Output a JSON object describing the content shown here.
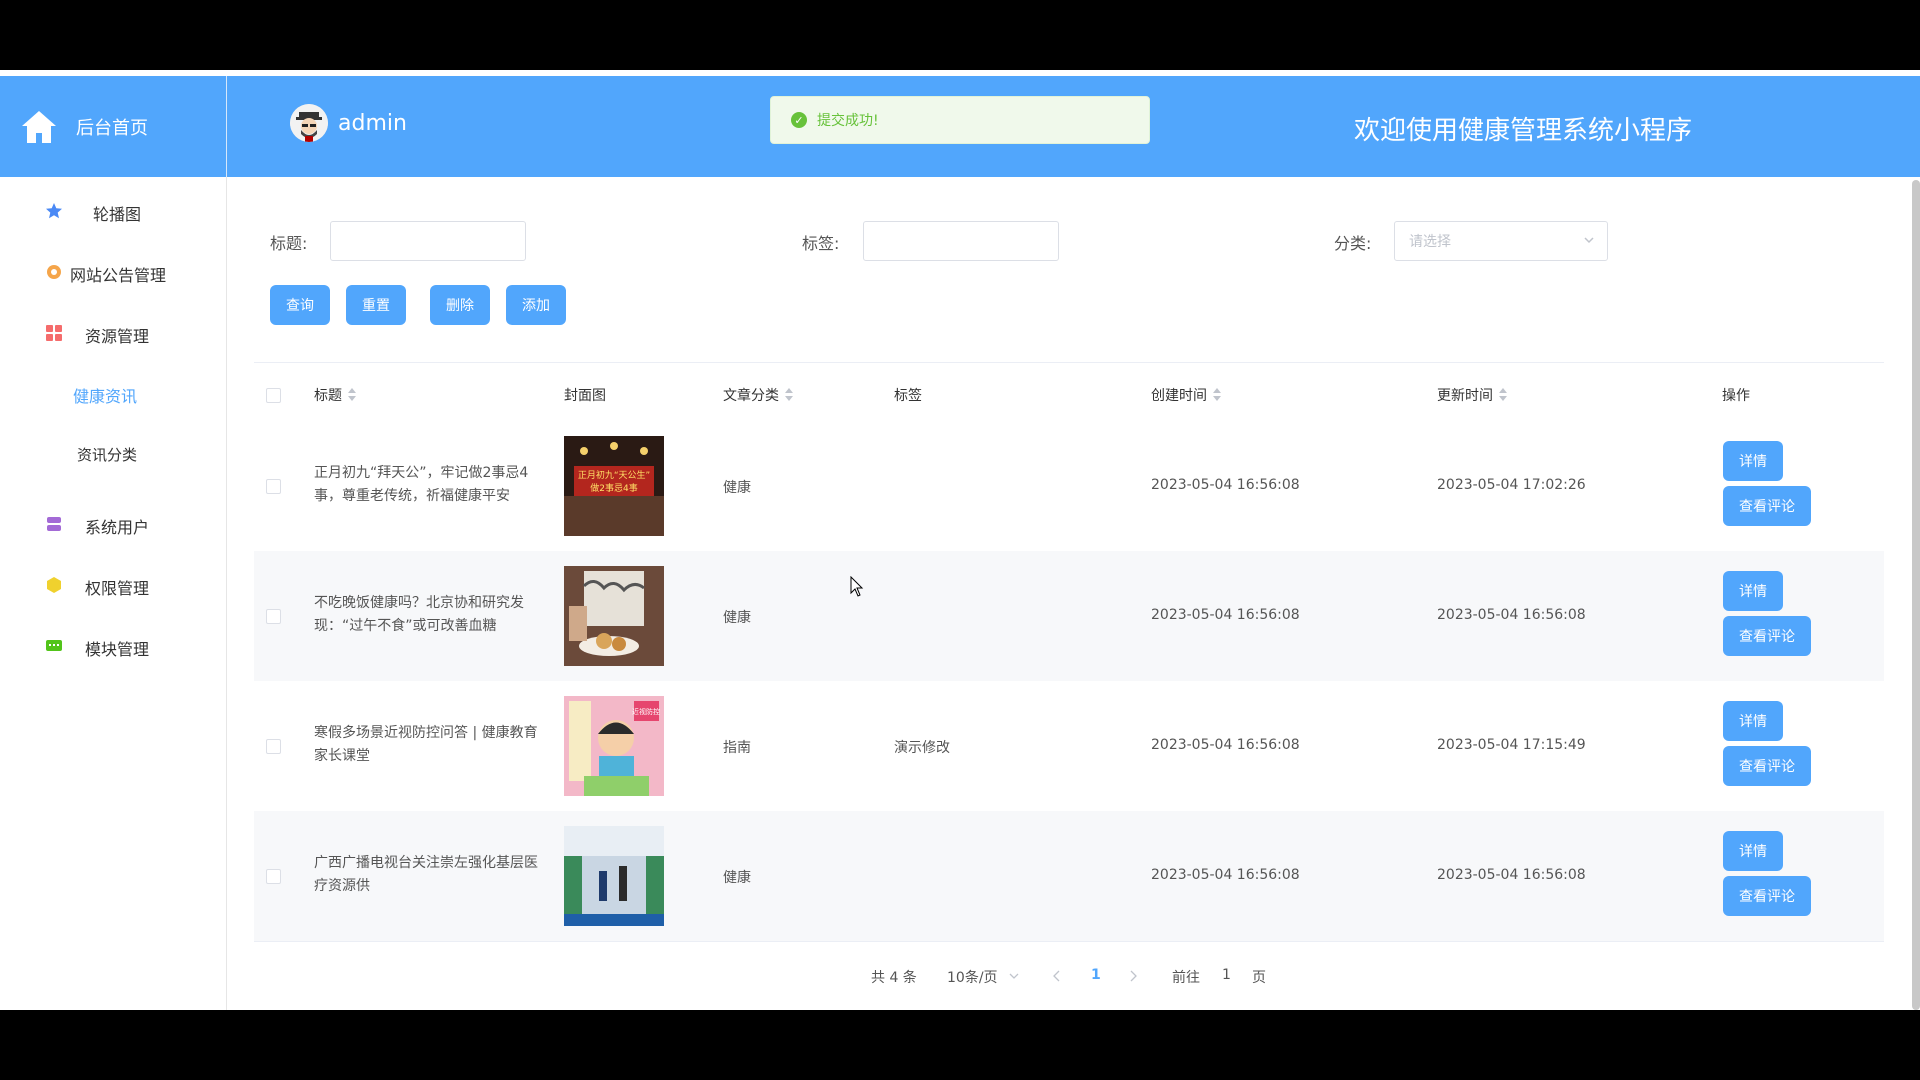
{
  "header": {
    "brand_label": "后台首页",
    "username": "admin",
    "toast_message": "提交成功!",
    "welcome": "欢迎使用健康管理系统小程序"
  },
  "sidebar": {
    "items": [
      {
        "label": "轮播图",
        "icon": "star-icon"
      },
      {
        "label": "网站公告管理",
        "icon": "gear-icon"
      },
      {
        "label": "资源管理",
        "icon": "grid-icon"
      },
      {
        "label": "健康资讯",
        "sub": true,
        "active": true
      },
      {
        "label": "资讯分类",
        "sub": true
      },
      {
        "label": "系统用户",
        "icon": "stack-icon"
      },
      {
        "label": "权限管理",
        "icon": "shield-icon"
      },
      {
        "label": "模块管理",
        "icon": "chat-icon"
      }
    ]
  },
  "filters": {
    "title_label": "标题:",
    "tag_label": "标签:",
    "category_label": "分类:",
    "category_placeholder": "请选择"
  },
  "actions": {
    "query": "查询",
    "reset": "重置",
    "delete": "删除",
    "add": "添加"
  },
  "table": {
    "columns": {
      "title": "标题",
      "cover": "封面图",
      "category": "文章分类",
      "tag": "标签",
      "created": "创建时间",
      "updated": "更新时间",
      "ops": "操作"
    },
    "rows": [
      {
        "title": "正月初九“拜天公”，牢记做2事忌4事，尊重老传统，祈福健康平安",
        "category": "健康",
        "tag": "",
        "created": "2023-05-04 16:56:08",
        "updated": "2023-05-04 17:02:26",
        "cover_text": "正月初九“天公生” 做2事忌4事"
      },
      {
        "title": "不吃晚饭健康吗？北京协和研究发现：“过午不食”或可改善血糖",
        "category": "健康",
        "tag": "",
        "created": "2023-05-04 16:56:08",
        "updated": "2023-05-04 16:56:08",
        "cover_text": ""
      },
      {
        "title": "寒假多场景近视防控问答 | 健康教育家长课堂",
        "category": "指南",
        "tag": "演示修改",
        "created": "2023-05-04 16:56:08",
        "updated": "2023-05-04 17:15:49",
        "cover_text": "近视防控"
      },
      {
        "title": "广西广播电视台关注崇左强化基层医疗资源供",
        "category": "健康",
        "tag": "",
        "created": "2023-05-04 16:56:08",
        "updated": "2023-05-04 16:56:08",
        "cover_text": ""
      }
    ],
    "detail_label": "详情",
    "comment_label": "查看评论"
  },
  "pagination": {
    "total": "共 4 条",
    "page_size": "10条/页",
    "current_page": "1",
    "goto_prefix": "前往",
    "goto_value": "1",
    "goto_suffix": "页"
  },
  "colors": {
    "primary": "#51a6fc",
    "success": "#67c23a"
  }
}
